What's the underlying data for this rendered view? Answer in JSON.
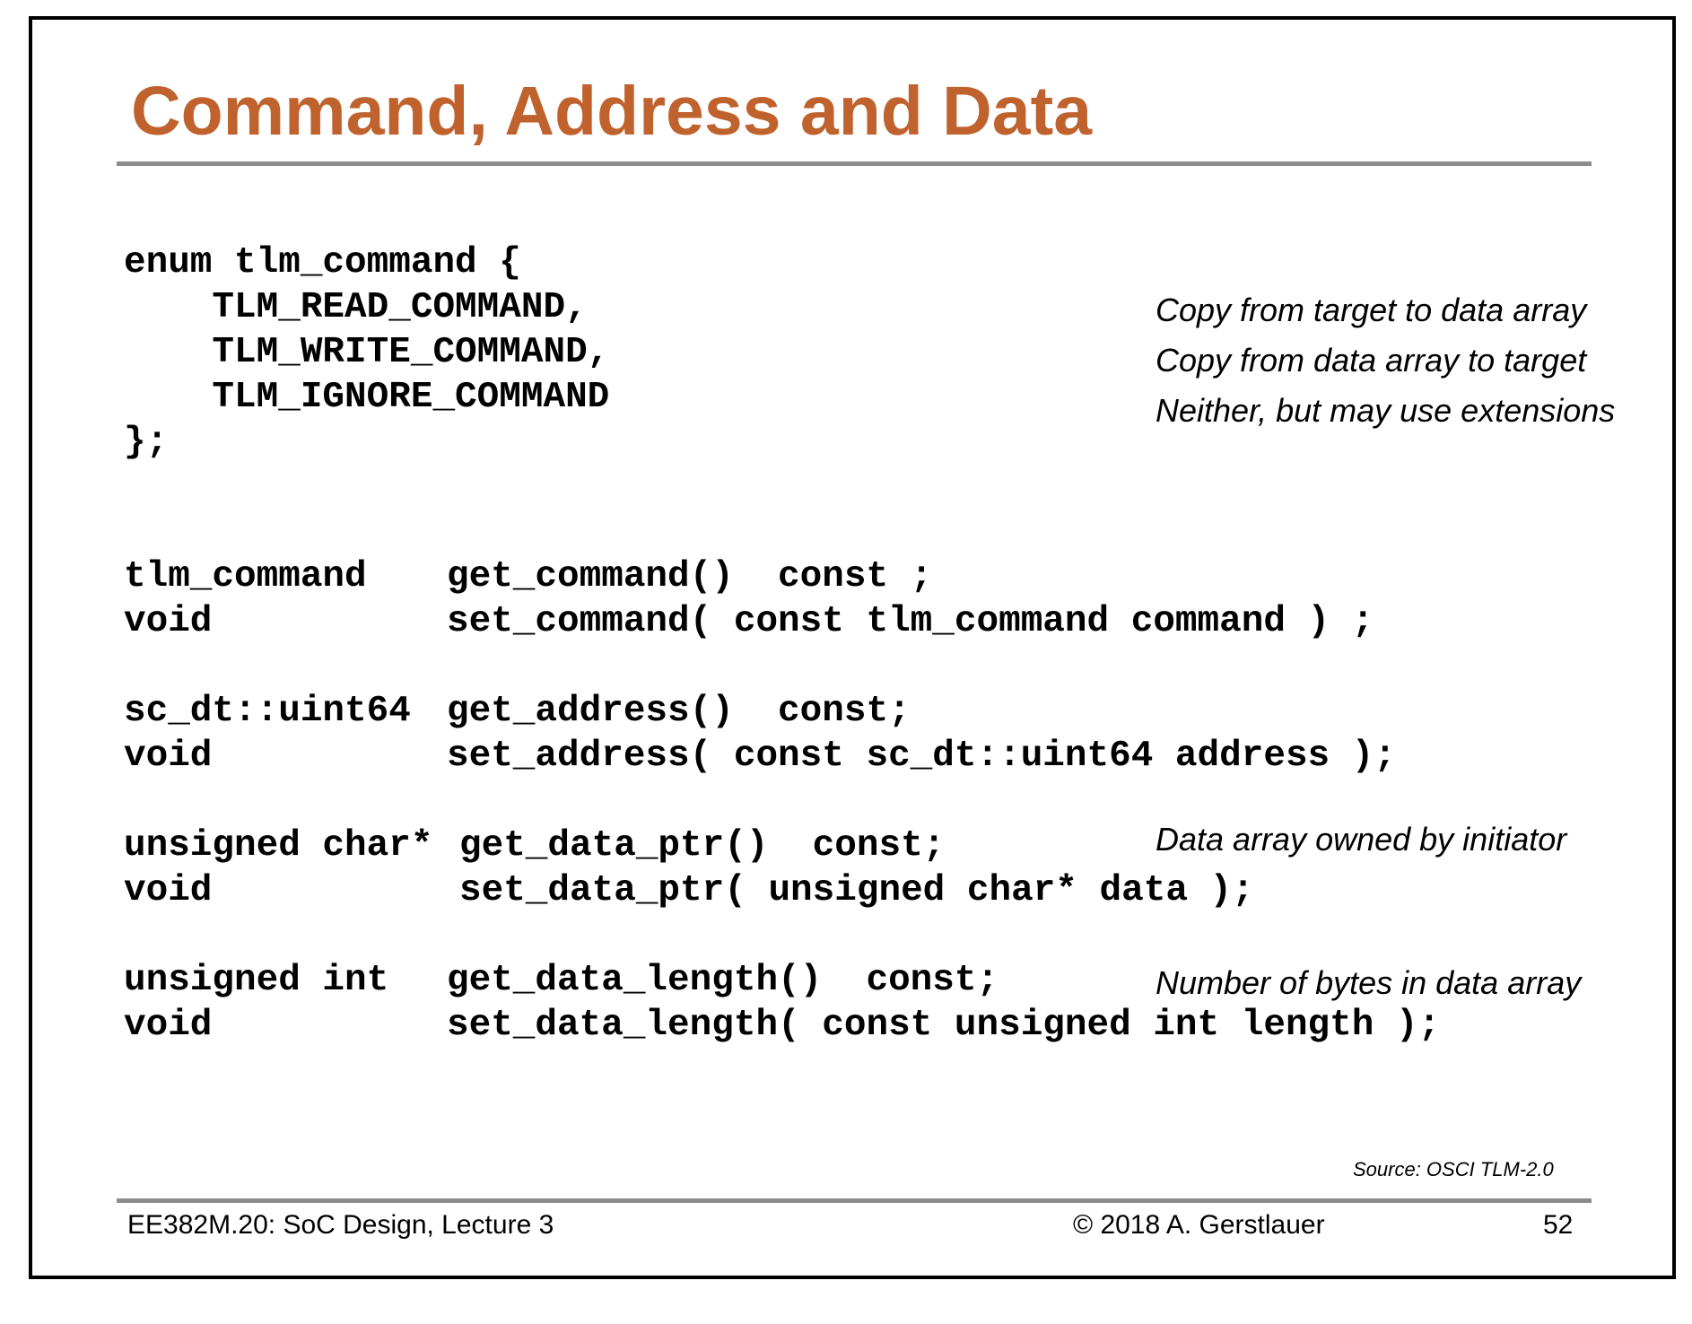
{
  "slide": {
    "title": "Command, Address and Data",
    "enum_block": {
      "line1": "enum tlm_command {",
      "line2": "    TLM_READ_COMMAND,",
      "line3": "    TLM_WRITE_COMMAND,",
      "line4": "    TLM_IGNORE_COMMAND",
      "line5": "};"
    },
    "enum_notes": {
      "read": "Copy from target to data array",
      "write": "Copy from data array to target",
      "ignore": "Neither, but may use extensions"
    },
    "methods": {
      "command": {
        "get_type": "tlm_command",
        "get_sig": "get_command()  const ;",
        "set_type": "void",
        "set_sig": "set_command( const tlm_command command ) ;"
      },
      "address": {
        "get_type": "sc_dt::uint64",
        "get_sig": "get_address()  const;",
        "set_type": "void",
        "set_sig": "set_address( const sc_dt::uint64 address );"
      },
      "data_ptr": {
        "get_type": "unsigned char*",
        "get_sig": "get_data_ptr()  const;",
        "set_type": "void",
        "set_sig": "set_data_ptr( unsigned char* data );",
        "note": "Data array owned by initiator"
      },
      "data_length": {
        "get_type": "unsigned int",
        "get_sig": "get_data_length()  const;",
        "set_type": "void",
        "set_sig": "set_data_length( const unsigned int length );",
        "note": "Number of bytes in data array"
      }
    },
    "source": "Source: OSCI TLM-2.0",
    "footer": {
      "course": "EE382M.20: SoC Design, Lecture 3",
      "copyright": "© 2018 A. Gerstlauer",
      "page_number": "52"
    },
    "colors": {
      "title": "#c0622d",
      "rule": "#8c8c8c",
      "frame": "#000000"
    }
  }
}
